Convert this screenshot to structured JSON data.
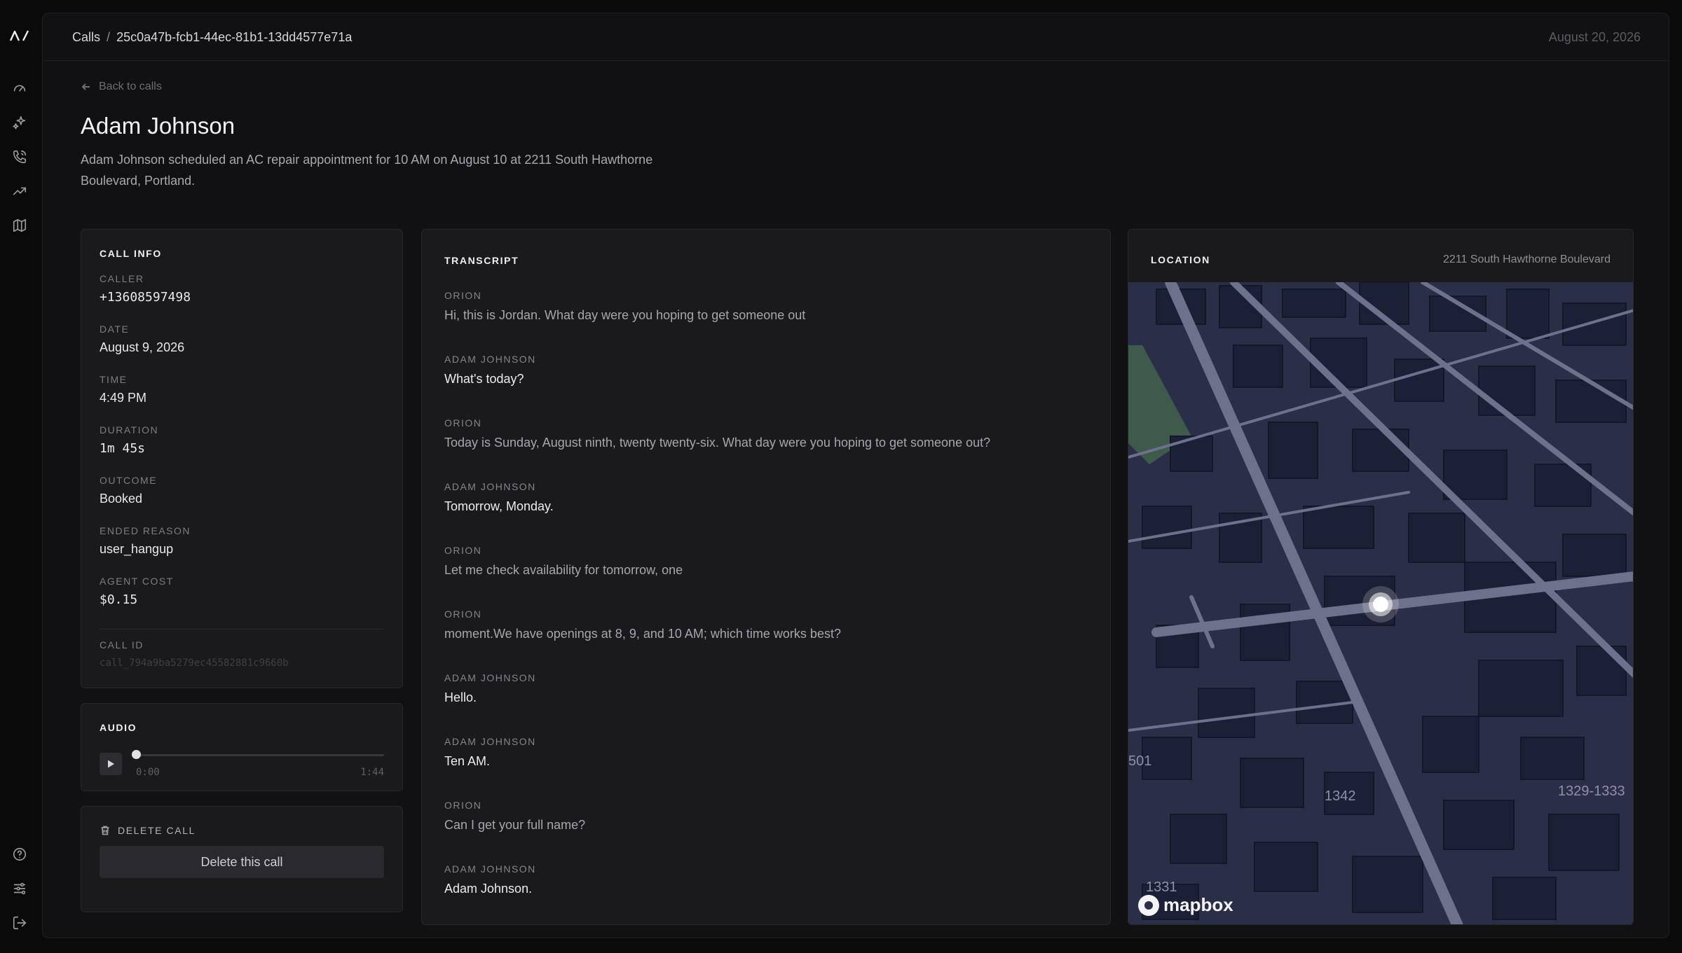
{
  "app": {
    "logo_text": "Λ/"
  },
  "sidebar": {
    "items": [
      {
        "name": "dashboard",
        "icon": "gauge-icon"
      },
      {
        "name": "agents",
        "icon": "sparkle-icon"
      },
      {
        "name": "calls",
        "icon": "phone-icon"
      },
      {
        "name": "analytics",
        "icon": "trending-up-icon"
      },
      {
        "name": "map",
        "icon": "map-icon"
      }
    ],
    "bottom": [
      {
        "name": "help",
        "icon": "help-circle-icon"
      },
      {
        "name": "settings",
        "icon": "sliders-icon"
      },
      {
        "name": "logout",
        "icon": "logout-icon"
      }
    ]
  },
  "header": {
    "breadcrumb_root": "Calls",
    "breadcrumb_sep": "/",
    "breadcrumb_id": "25c0a47b-fcb1-44ec-81b1-13dd4577e71a",
    "date": "August 20, 2026"
  },
  "page": {
    "back_label": "Back to calls",
    "title": "Adam Johnson",
    "summary": "Adam Johnson scheduled an AC repair appointment for 10 AM on August 10 at 2211 South Hawthorne Boulevard, Portland."
  },
  "call_info": {
    "title": "CALL INFO",
    "caller_label": "CALLER",
    "caller": "+13608597498",
    "date_label": "DATE",
    "date": "August 9, 2026",
    "time_label": "TIME",
    "time": "4:49 PM",
    "duration_label": "DURATION",
    "duration": "1m 45s",
    "outcome_label": "OUTCOME",
    "outcome": "Booked",
    "ended_reason_label": "ENDED REASON",
    "ended_reason": "user_hangup",
    "agent_cost_label": "AGENT COST",
    "agent_cost": "$0.15",
    "call_id_label": "CALL ID",
    "call_id": "call_794a9ba5279ec45582881c9660b"
  },
  "audio": {
    "title": "AUDIO",
    "current_time": "0:00",
    "total_time": "1:44",
    "progress": 0
  },
  "delete": {
    "title": "DELETE CALL",
    "button_label": "Delete this call"
  },
  "transcript": {
    "title": "TRANSCRIPT",
    "messages": [
      {
        "speaker": "ORION",
        "role": "agent",
        "text": "Hi, this is Jordan. What day were you hoping to get someone out"
      },
      {
        "speaker": "ADAM JOHNSON",
        "role": "user",
        "text": "What's today?"
      },
      {
        "speaker": "ORION",
        "role": "agent",
        "text": "Today is Sunday, August ninth, twenty twenty-six. What day were you hoping to get someone out?"
      },
      {
        "speaker": "ADAM JOHNSON",
        "role": "user",
        "text": "Tomorrow, Monday."
      },
      {
        "speaker": "ORION",
        "role": "agent",
        "text": "Let me check availability for tomorrow, one"
      },
      {
        "speaker": "ORION",
        "role": "agent",
        "text": "moment.We have openings at 8, 9, and 10 AM; which time works best?"
      },
      {
        "speaker": "ADAM JOHNSON",
        "role": "user",
        "text": "Hello."
      },
      {
        "speaker": "ADAM JOHNSON",
        "role": "user",
        "text": "Ten AM."
      },
      {
        "speaker": "ORION",
        "role": "agent",
        "text": "Can I get your full name?"
      },
      {
        "speaker": "ADAM JOHNSON",
        "role": "user",
        "text": "Adam Johnson."
      }
    ]
  },
  "location": {
    "title": "LOCATION",
    "address": "2211 South Hawthorne Boulevard",
    "map_labels": [
      "1342",
      "1329-1333",
      "1331",
      "501"
    ],
    "attribution": "mapbox"
  },
  "colors": {
    "background": "#0a0a0b",
    "panel": "#1a1a1d",
    "map_base": "#2b2e47",
    "building": "#1c2036",
    "road": "#6d718c"
  }
}
